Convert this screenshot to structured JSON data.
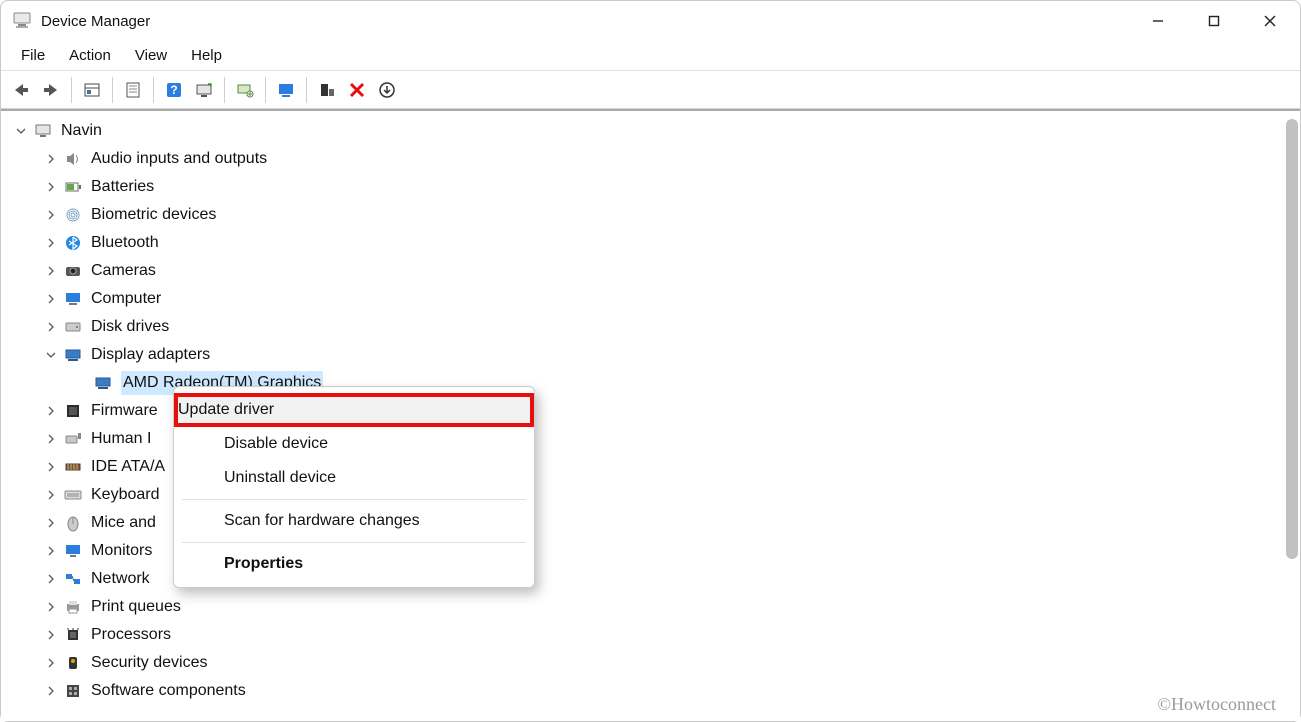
{
  "window": {
    "title": "Device Manager"
  },
  "menu": {
    "file": "File",
    "action": "Action",
    "view": "View",
    "help": "Help"
  },
  "toolbar_icons": {
    "back": "back-icon",
    "forward": "forward-icon",
    "show_hidden": "show-hidden-icon",
    "properties": "properties-icon",
    "help": "help-icon",
    "scan": "scan-icon",
    "update": "update-icon",
    "monitor": "monitor-icon",
    "uninstall": "uninstall-icon",
    "remove": "remove-icon",
    "install": "install-icon"
  },
  "tree": {
    "root": "Navin",
    "nodes": [
      {
        "label": "Audio inputs and outputs",
        "icon": "speaker-icon"
      },
      {
        "label": "Batteries",
        "icon": "battery-icon"
      },
      {
        "label": "Biometric devices",
        "icon": "fingerprint-icon"
      },
      {
        "label": "Bluetooth",
        "icon": "bluetooth-icon"
      },
      {
        "label": "Cameras",
        "icon": "camera-icon"
      },
      {
        "label": "Computer",
        "icon": "computer-icon"
      },
      {
        "label": "Disk drives",
        "icon": "disk-icon"
      },
      {
        "label": "Display adapters",
        "icon": "display-adapter-icon",
        "expanded": true,
        "children": [
          {
            "label": "AMD Radeon(TM) Graphics",
            "icon": "display-adapter-icon",
            "selected": true
          }
        ]
      },
      {
        "label": "Firmware",
        "icon": "firmware-icon",
        "truncated": "Firmware"
      },
      {
        "label": "Human Interface Devices",
        "icon": "hid-icon",
        "truncated": "Human I"
      },
      {
        "label": "IDE ATA/ATAPI controllers",
        "icon": "ide-icon",
        "truncated": "IDE ATA/A"
      },
      {
        "label": "Keyboards",
        "icon": "keyboard-icon",
        "truncated": "Keyboard"
      },
      {
        "label": "Mice and other pointing devices",
        "icon": "mouse-icon",
        "truncated": "Mice and"
      },
      {
        "label": "Monitors",
        "icon": "monitor-icon",
        "truncated": "Monitors"
      },
      {
        "label": "Network adapters",
        "icon": "network-icon",
        "truncated": "Network"
      },
      {
        "label": "Print queues",
        "icon": "printer-icon"
      },
      {
        "label": "Processors",
        "icon": "processor-icon"
      },
      {
        "label": "Security devices",
        "icon": "security-icon"
      },
      {
        "label": "Software components",
        "icon": "software-icon"
      }
    ]
  },
  "context_menu": {
    "update_driver": "Update driver",
    "disable_device": "Disable device",
    "uninstall_device": "Uninstall device",
    "scan_hardware": "Scan for hardware changes",
    "properties": "Properties"
  },
  "watermark": "©Howtoconnect"
}
